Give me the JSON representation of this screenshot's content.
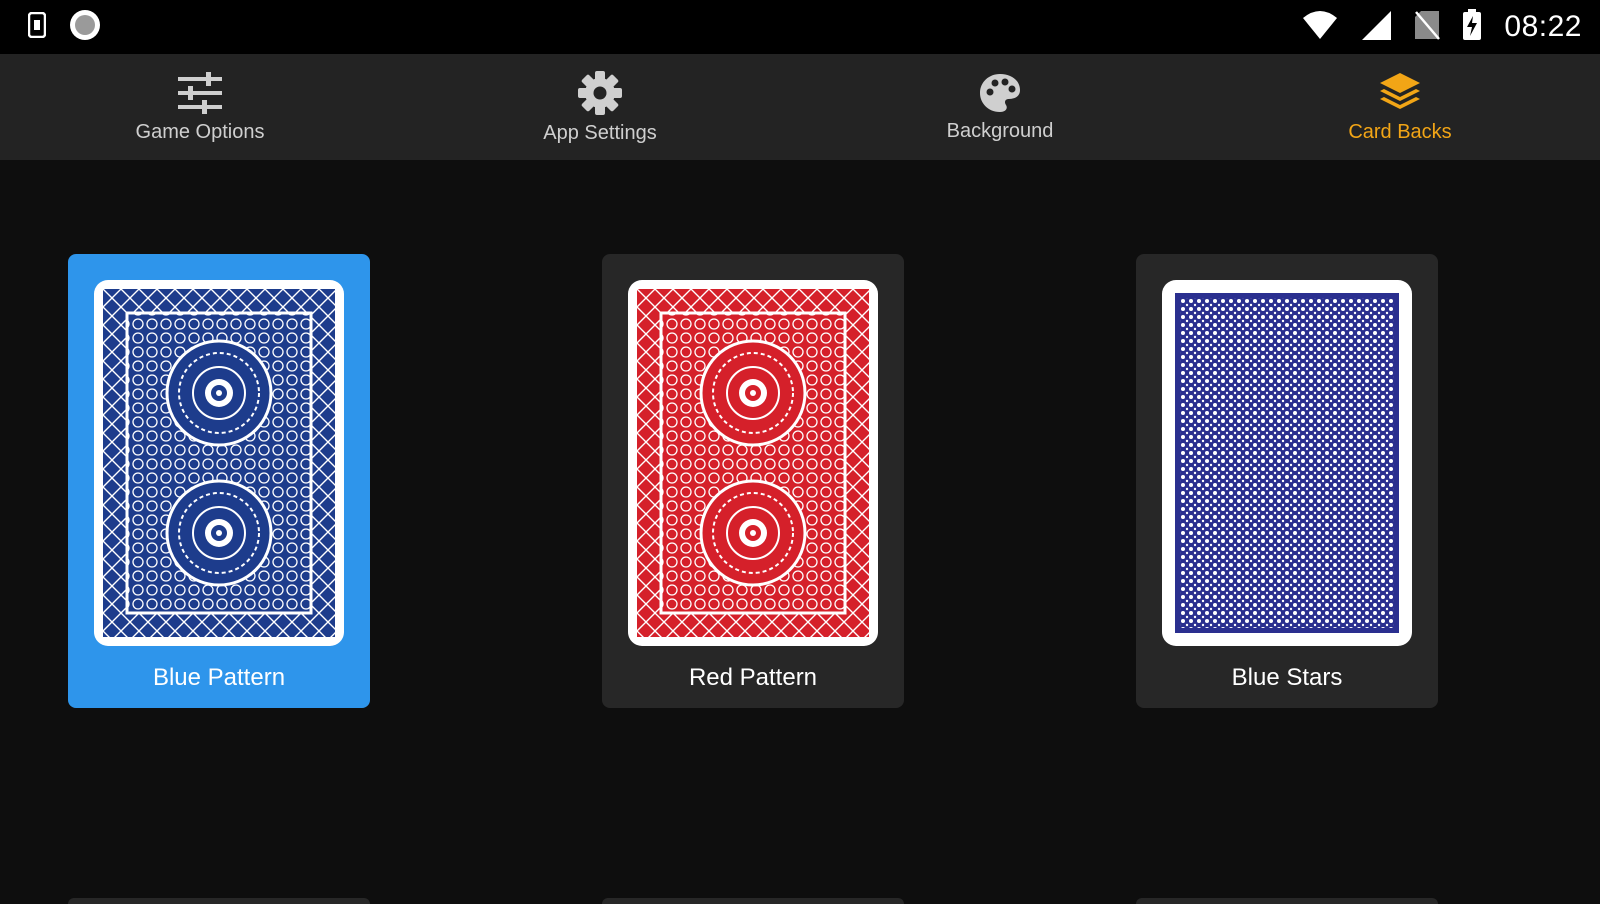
{
  "status_bar": {
    "time": "08:22",
    "left_icons": [
      "sim-card-icon",
      "record-icon"
    ],
    "right_icons": [
      "wifi-icon",
      "cell-signal-icon",
      "no-sim-icon",
      "battery-charging-icon"
    ]
  },
  "tabs": [
    {
      "label": "Game Options",
      "icon": "sliders-icon",
      "active": false
    },
    {
      "label": "App Settings",
      "icon": "gear-icon",
      "active": false
    },
    {
      "label": "Background",
      "icon": "palette-icon",
      "active": false
    },
    {
      "label": "Card Backs",
      "icon": "layers-icon",
      "active": true
    }
  ],
  "card_backs": [
    {
      "label": "Blue Pattern",
      "color": "#1d3c8c",
      "style": "pattern",
      "selected": true
    },
    {
      "label": "Red Pattern",
      "color": "#d5202a",
      "style": "pattern",
      "selected": false
    },
    {
      "label": "Blue Stars",
      "color": "#2a2f8f",
      "style": "dots",
      "selected": false
    }
  ],
  "colors": {
    "accent_active_tab": "#f2a516",
    "selected_tile": "#2e95eb",
    "tile": "#272727",
    "tab_bar": "#232323",
    "background": "#0e0e0e"
  }
}
